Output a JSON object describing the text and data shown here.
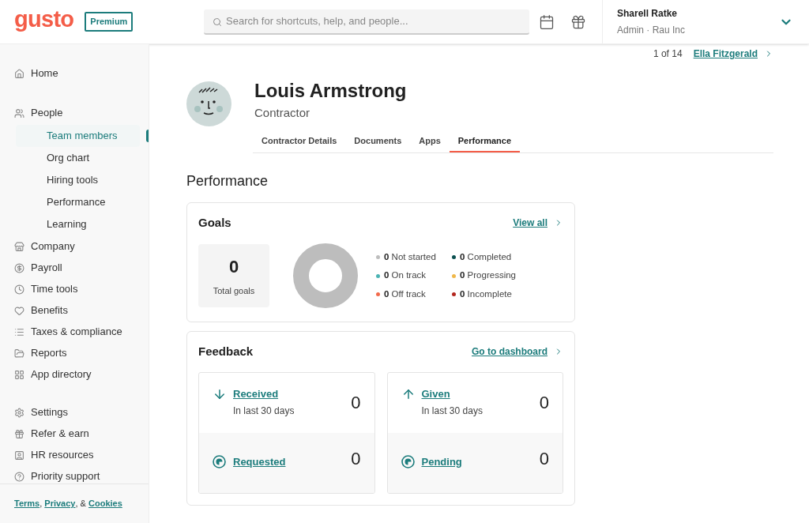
{
  "header": {
    "logo": "gusto",
    "plan_badge": "Premium",
    "search": {
      "placeholder": "Search for shortcuts, help, and people..."
    },
    "user": {
      "name": "Sharell Ratke",
      "role": "Admin · Rau Inc"
    }
  },
  "sidebar": {
    "groups": [
      [
        {
          "label": "Home",
          "selected": false
        }
      ],
      [
        {
          "label": "People",
          "selected": false,
          "children": [
            {
              "label": "Team members",
              "selected": true
            },
            {
              "label": "Org chart",
              "selected": false
            },
            {
              "label": "Hiring tools",
              "selected": false
            },
            {
              "label": "Performance",
              "selected": false
            },
            {
              "label": "Learning",
              "selected": false
            }
          ]
        },
        {
          "label": "Company",
          "selected": false
        },
        {
          "label": "Payroll",
          "selected": false
        },
        {
          "label": "Time tools",
          "selected": false
        },
        {
          "label": "Benefits",
          "selected": false
        },
        {
          "label": "Taxes & compliance",
          "selected": false
        },
        {
          "label": "Reports",
          "selected": false
        },
        {
          "label": "App directory",
          "selected": false
        }
      ],
      [
        {
          "label": "Settings",
          "selected": false
        },
        {
          "label": "Refer & earn",
          "selected": false
        },
        {
          "label": "HR resources",
          "selected": false
        },
        {
          "label": "Priority support",
          "selected": false
        }
      ]
    ],
    "footer": {
      "links": [
        "Terms",
        "Privacy",
        "Cookies"
      ],
      "separators": [
        ", ",
        ", & "
      ]
    }
  },
  "pager": {
    "position": "1 of 14",
    "next": "Ella Fitzgerald"
  },
  "profile": {
    "name": "Louis Armstrong",
    "role": "Contractor"
  },
  "tabs": [
    {
      "label": "Contractor Details",
      "selected": false
    },
    {
      "label": "Documents",
      "selected": false
    },
    {
      "label": "Apps",
      "selected": false
    },
    {
      "label": "Performance",
      "selected": true
    }
  ],
  "section_title": "Performance",
  "goals": {
    "title": "Goals",
    "link": "View all",
    "total": "0",
    "total_label": "Total goals",
    "legend": [
      {
        "count": "0",
        "label": "Not started",
        "color": "#bdbdbd"
      },
      {
        "count": "0",
        "label": "Completed",
        "color": "#0a4f4f"
      },
      {
        "count": "0",
        "label": "On track",
        "color": "#4bb3b3"
      },
      {
        "count": "0",
        "label": "Progressing",
        "color": "#f0b84a"
      },
      {
        "count": "0",
        "label": "Off track",
        "color": "#f26a4b"
      },
      {
        "count": "0",
        "label": "Incomplete",
        "color": "#b3261e"
      }
    ]
  },
  "feedback": {
    "title": "Feedback",
    "link": "Go to dashboard",
    "cards": [
      {
        "top": {
          "label": "Received",
          "sub": "In last 30 days",
          "value": "0"
        },
        "bottom": {
          "label": "Requested",
          "value": "0"
        }
      },
      {
        "top": {
          "label": "Given",
          "sub": "In last 30 days",
          "value": "0"
        },
        "bottom": {
          "label": "Pending",
          "value": "0"
        }
      }
    ]
  }
}
